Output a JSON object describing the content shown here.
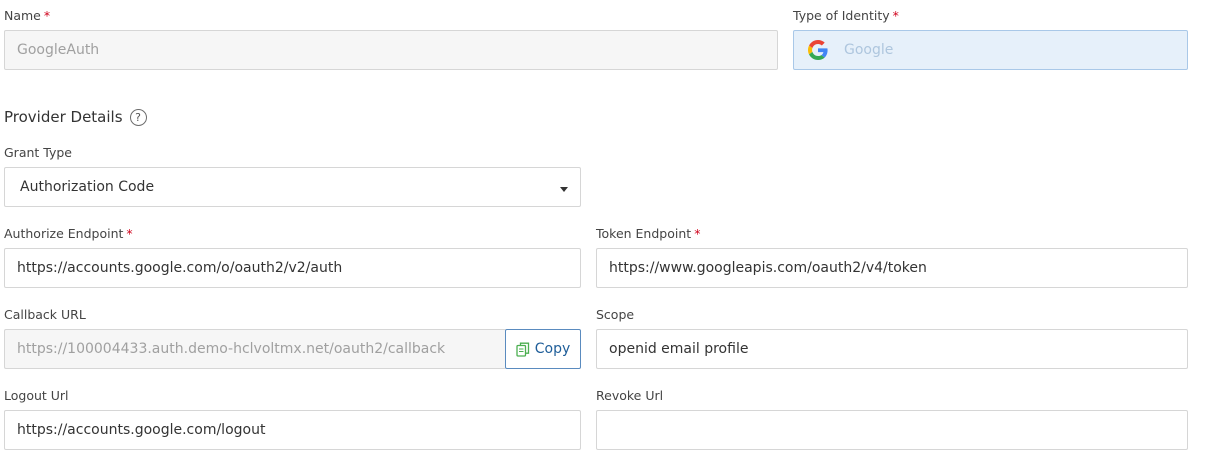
{
  "name": {
    "label": "Name",
    "value": "GoogleAuth"
  },
  "identity_type": {
    "label": "Type of Identity",
    "value": "Google"
  },
  "provider": {
    "title": "Provider Details",
    "help_glyph": "?",
    "grant_type": {
      "label": "Grant Type",
      "value": "Authorization Code"
    },
    "authorize_endpoint": {
      "label": "Authorize Endpoint",
      "value": "https://accounts.google.com/o/oauth2/v2/auth"
    },
    "token_endpoint": {
      "label": "Token Endpoint",
      "value": "https://www.googleapis.com/oauth2/v4/token"
    },
    "callback_url": {
      "label": "Callback URL",
      "value": "https://100004433.auth.demo-hclvoltmx.net/oauth2/callback",
      "copy_label": "Copy"
    },
    "scope": {
      "label": "Scope",
      "value": "openid email profile"
    },
    "logout_url": {
      "label": "Logout Url",
      "value": "https://accounts.google.com/logout"
    },
    "revoke_url": {
      "label": "Revoke Url",
      "value": ""
    }
  },
  "required_marker": "*",
  "colors": {
    "required": "#d0021b",
    "identity_bg": "#e6f0fa",
    "accent": "#1f5e99"
  }
}
